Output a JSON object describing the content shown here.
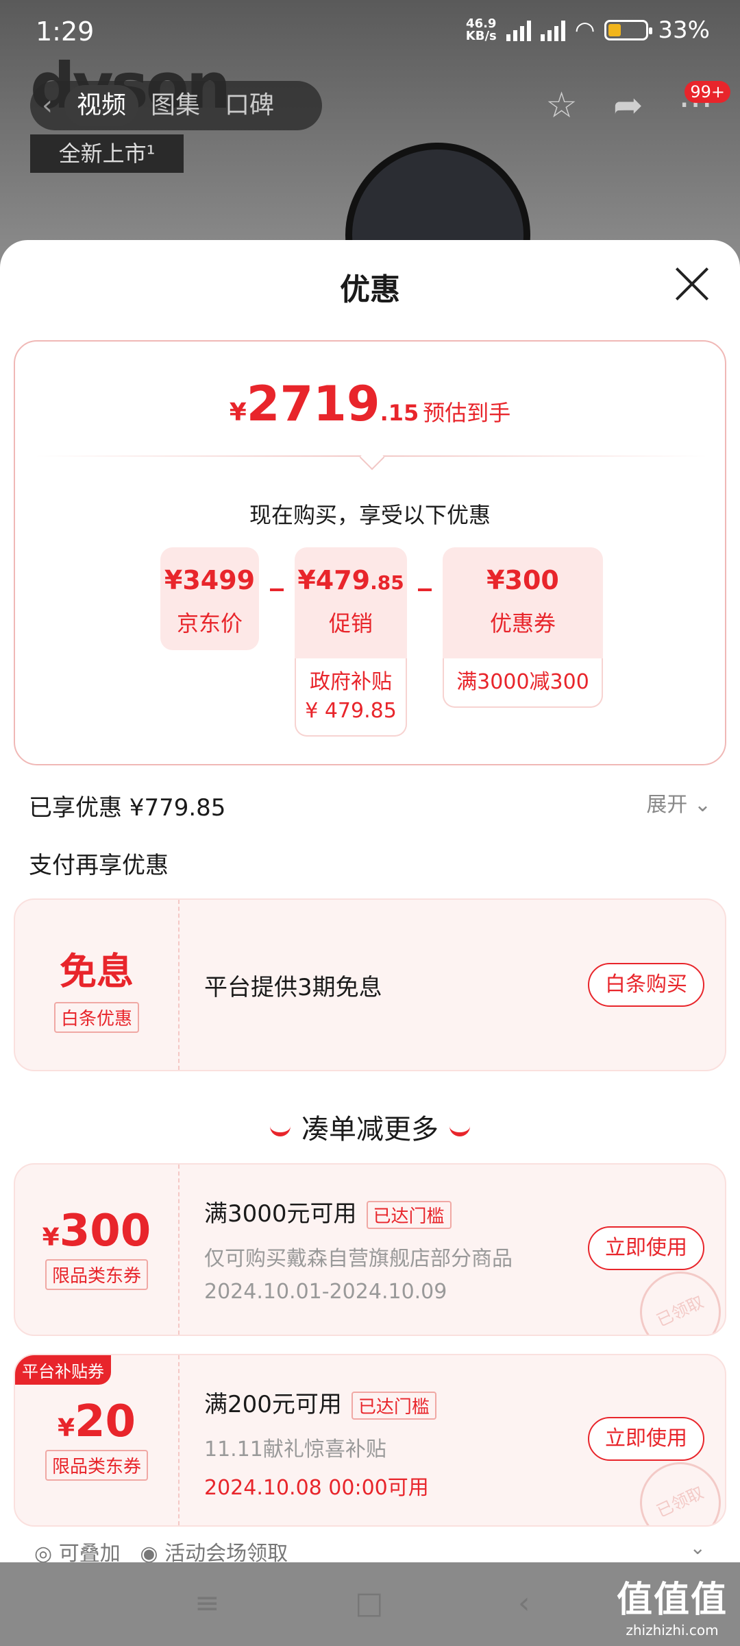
{
  "status_bar": {
    "time": "1:29",
    "net_speed": "46.9",
    "net_unit": "KB/s",
    "battery": "33%"
  },
  "header": {
    "brand": "dyson",
    "tabs": [
      "视频",
      "图集",
      "口碑"
    ],
    "active_tab": 0,
    "badge": "99+",
    "new_tag": "全新上市¹"
  },
  "sheet": {
    "title": "优惠"
  },
  "summary": {
    "currency": "¥",
    "price_int": "2719",
    "price_dec": ".15",
    "price_label": "预估到手",
    "subtitle": "现在购买，享受以下优惠",
    "calc": [
      {
        "value": "¥3499",
        "value_small": "",
        "name": "京东价",
        "sub": ""
      },
      {
        "value": "¥479",
        "value_small": ".85",
        "name": "促销",
        "sub": "政府补贴 ¥ 479.85"
      },
      {
        "value": "¥300",
        "value_small": "",
        "name": "优惠券",
        "sub": "满3000减300"
      }
    ]
  },
  "enjoyed": {
    "text": "已享优惠 ¥779.85",
    "expand": "展开"
  },
  "pay_more": {
    "title": "支付再享优惠"
  },
  "baitiao": {
    "big": "免息",
    "tag": "白条优惠",
    "desc": "平台提供3期免息",
    "button": "白条购买"
  },
  "more": {
    "title": "凑单减更多"
  },
  "coupons": [
    {
      "corner": "",
      "amount": "300",
      "tag": "限品类东券",
      "title": "满3000元可用",
      "reached": "已达门槛",
      "desc": "仅可购买戴森自营旗舰店部分商品",
      "date": "2024.10.01-2024.10.09",
      "button": "立即使用",
      "stamp": "已领取"
    },
    {
      "corner": "平台补贴券",
      "amount": "20",
      "tag": "限品类东券",
      "title": "满200元可用",
      "reached": "已达门槛",
      "desc": "11.11献礼惊喜补贴",
      "date": "2024.10.08 00:00可用",
      "button": "立即使用",
      "stamp": "已领取"
    }
  ],
  "footer": {
    "stackable": "可叠加",
    "venue": "活动会场领取"
  },
  "watermark": {
    "text": "值值值",
    "domain": "zhizhizhi.com"
  },
  "colors": {
    "accent": "#e8252b",
    "panel_bg": "#fdf3f2"
  }
}
